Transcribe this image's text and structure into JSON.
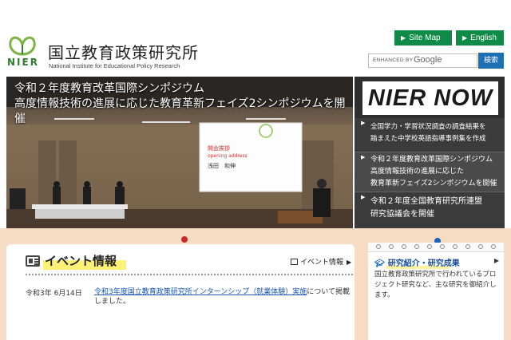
{
  "header": {
    "logo_abbr": "NIER",
    "title": "国立教育政策研究所",
    "subtitle": "National Institute for Educational Policy Research",
    "site_map_label": "Site Map",
    "english_label": "English",
    "search_enhanced": "ENHANCED BY",
    "search_google": "Google",
    "search_button": "検索",
    "brand_color": "#0f8a47"
  },
  "hero": {
    "caption_line1": "令和２年度教育改革国際シンポジウム",
    "caption_line2": "高度情報技術の進展に応じた教育革新フェイズ2シンポジウムを開催",
    "slide_title_ja": "開会挨拶",
    "slide_title_en": "opening address",
    "slide_name": "浅田　和伸"
  },
  "nier_now": {
    "title": "NIER NOW",
    "items": [
      {
        "line1": "全国学力・学習状況調査の調査結果を",
        "line2": "踏まえた中学校英語指導事例集を作成"
      },
      {
        "line1": "令和２年度教育改革国際シンポジウム",
        "line2": "高度情報技術の進展に応じた",
        "line3": "教育革新フェイズ2シンポジウムを開催"
      },
      {
        "line1": "令和２年度全国教育研究所連盟",
        "line2": "研究協議会を開催"
      }
    ]
  },
  "events": {
    "title": "イベント情報",
    "more_label": "イベント情報",
    "items": [
      {
        "date": "令和3年  6月14日",
        "link": "令和3年度国立教育政策研究所インターンシップ（就業体験）実施",
        "suffix": "について掲載しました。"
      }
    ]
  },
  "research": {
    "title": "研究紹介・研究成果",
    "body": "国立教育政策研究所で行われているプロジェクト研究など、主な研究を御紹介します。"
  }
}
